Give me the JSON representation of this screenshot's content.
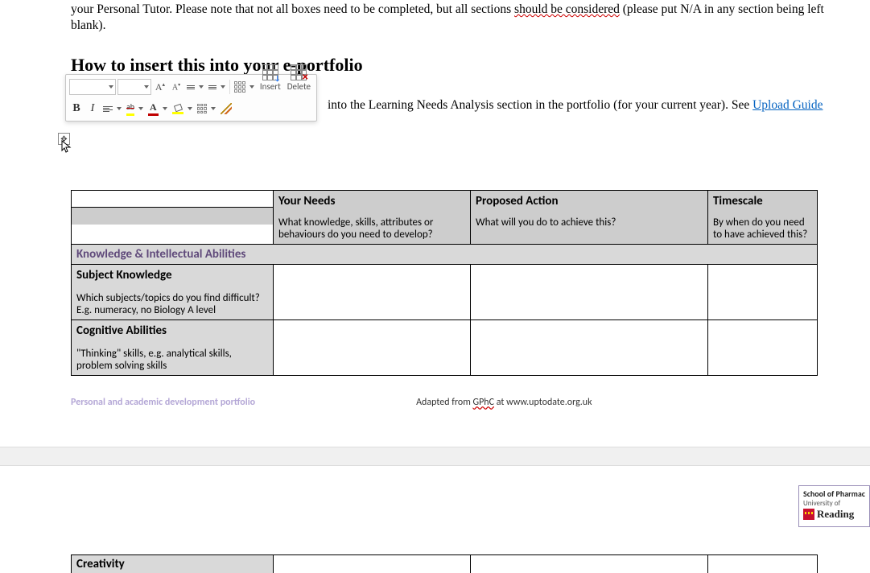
{
  "intro": {
    "prefix": "your Personal Tutor. Please note that not all boxes need to be completed, but all sections ",
    "wavy": "should be considered",
    "suffix": " (please put N/A in any section being left blank)."
  },
  "heading": "How to insert this into your e-portfolio",
  "body_after_toolbar": "into the Learning Needs Analysis section in the portfolio (for your current year). See ",
  "upload_link": "Upload Guide",
  "toolbar": {
    "insert": "Insert",
    "delete": "Delete"
  },
  "table": {
    "col_needs_title": "Your Needs",
    "col_needs_sub": "What knowledge, skills, attributes or behaviours do you need to develop?",
    "col_action_title": "Proposed Action",
    "col_action_sub": "What will you do to achieve this?",
    "col_time_title": "Timescale",
    "col_time_sub": "By when do you need to have achieved this?",
    "section1": "Knowledge & Intellectual Abilities",
    "row1_title": "Subject Knowledge",
    "row1_sub": "Which subjects/topics do you find difficult? E.g. numeracy, no Biology A level",
    "row2_title": "Cognitive Abilities",
    "row2_sub": "\"Thinking\" skills, e.g. analytical skills, problem solving skills"
  },
  "footer": {
    "left": "Personal and academic development portfolio",
    "right_pre": "Adapted from ",
    "right_wavy": "GPhC",
    "right_post": " at www.uptodate.org.uk"
  },
  "logo": {
    "line1": "School of Pharmac",
    "line2": "University of",
    "line3": "Reading"
  },
  "next_section": "Creativity"
}
